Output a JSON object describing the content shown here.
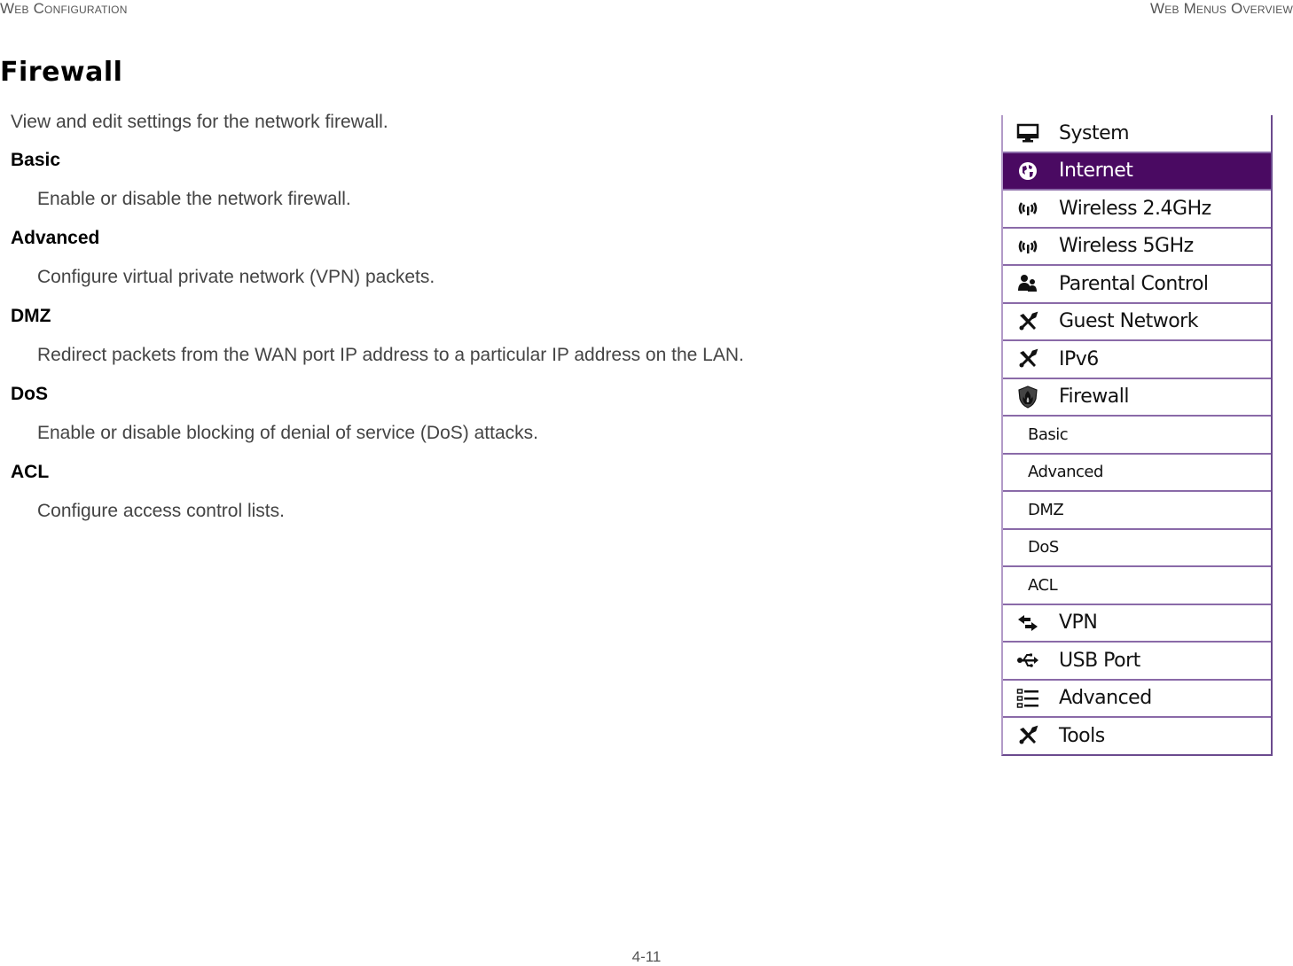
{
  "header": {
    "left": "Web Configuration",
    "right": "Web Menus Overview"
  },
  "page_title": "Firewall",
  "intro": "View and edit settings for the network firewall.",
  "sections": [
    {
      "term": "Basic",
      "description": "Enable or disable the network firewall."
    },
    {
      "term": "Advanced",
      "description": "Configure virtual private network (VPN) packets."
    },
    {
      "term": "DMZ",
      "description": "Redirect packets from the WAN port IP address to a particular IP address on the LAN."
    },
    {
      "term": "DoS",
      "description": "Enable or disable blocking of denial of service (DoS) attacks."
    },
    {
      "term": "ACL",
      "description": "Configure access control lists."
    }
  ],
  "menu": {
    "accent_color": "#4a0a62",
    "items": [
      {
        "label": "System",
        "icon": "monitor-icon"
      },
      {
        "label": "Internet",
        "icon": "globe-icon",
        "active": true
      },
      {
        "label": "Wireless 2.4GHz",
        "icon": "wireless-icon"
      },
      {
        "label": "Wireless 5GHz",
        "icon": "wireless-icon"
      },
      {
        "label": "Parental Control",
        "icon": "users-icon"
      },
      {
        "label": "Guest Network",
        "icon": "tools-icon"
      },
      {
        "label": "IPv6",
        "icon": "tools-icon"
      },
      {
        "label": "Firewall",
        "icon": "shield-fire-icon"
      },
      {
        "label": "Basic",
        "sub": true
      },
      {
        "label": "Advanced",
        "sub": true
      },
      {
        "label": "DMZ",
        "sub": true
      },
      {
        "label": "DoS",
        "sub": true
      },
      {
        "label": "ACL",
        "sub": true
      },
      {
        "label": "VPN",
        "icon": "exchange-arrows-icon"
      },
      {
        "label": "USB Port",
        "icon": "usb-icon"
      },
      {
        "label": "Advanced",
        "icon": "list-icon"
      },
      {
        "label": "Tools",
        "icon": "tools-icon"
      }
    ]
  },
  "footer": {
    "page_number": "4-11"
  }
}
